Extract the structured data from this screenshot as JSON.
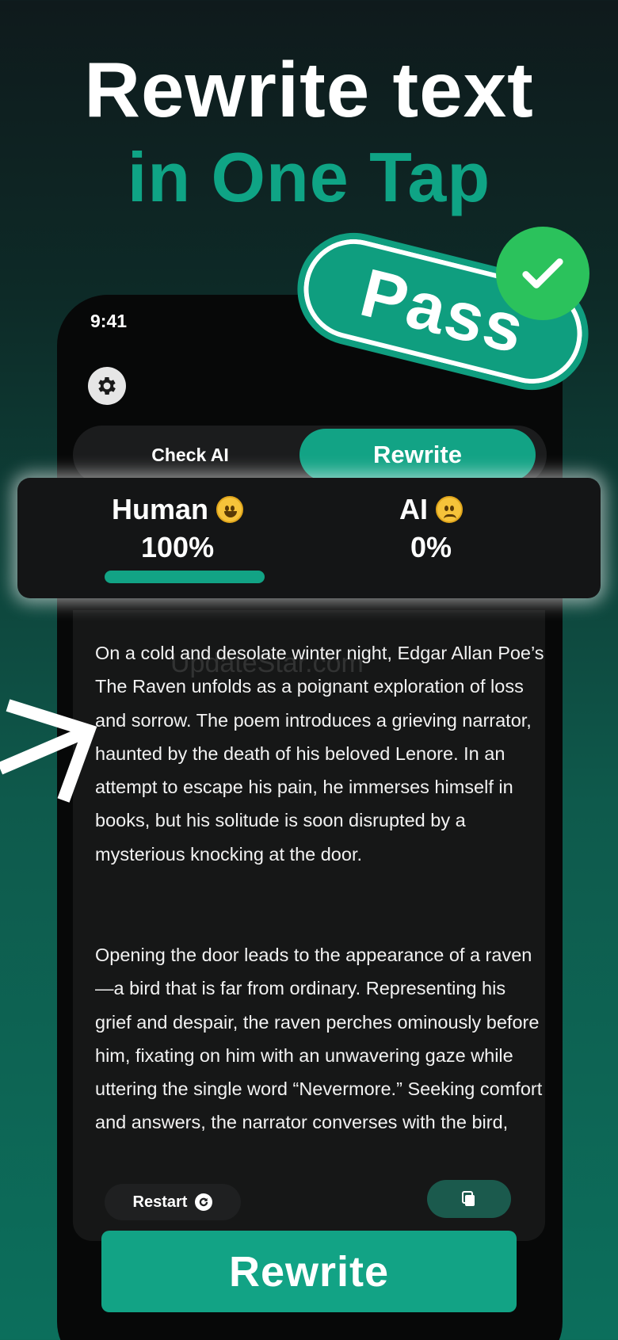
{
  "hero": {
    "line1": "Rewrite text",
    "line2": "in One Tap"
  },
  "badge": {
    "label": "Pass"
  },
  "status": {
    "time": "9:41"
  },
  "tabs": {
    "check_ai": "Check AI",
    "rewrite": "Rewrite"
  },
  "result": {
    "human_label": "Human",
    "human_value": "100%",
    "ai_label": "AI",
    "ai_value": "0%",
    "human_fraction": 1.0
  },
  "content": {
    "watermark": "UpdateStar.com",
    "paragraph1": "On a cold and desolate winter night, Edgar Allan Poe’s The Raven unfolds as a poignant exploration of loss and sorrow. The poem introduces a grieving narrator, haunted by the death of his beloved Lenore. In an attempt to escape his pain, he immerses himself in books, but his solitude is soon disrupted by a mysterious knocking at the door.",
    "paragraph2": "Opening the door leads to the appearance of a raven—a bird that is far from ordinary. Representing his grief and despair, the raven perches ominously before him, fixating on him with an unwavering gaze while uttering the single word “Nevermore.” Seeking comfort and answers, the narrator converses with the bird,"
  },
  "actions": {
    "restart": "Restart",
    "main": "Rewrite"
  },
  "icons": {
    "settings": "gear-icon",
    "restart": "restart-icon",
    "copy": "copy-icon",
    "check": "checkmark-icon",
    "arrow": "arrow-icon"
  },
  "colors": {
    "accent": "#12a385",
    "check_green": "#2bc25c",
    "panel": "#161717"
  }
}
